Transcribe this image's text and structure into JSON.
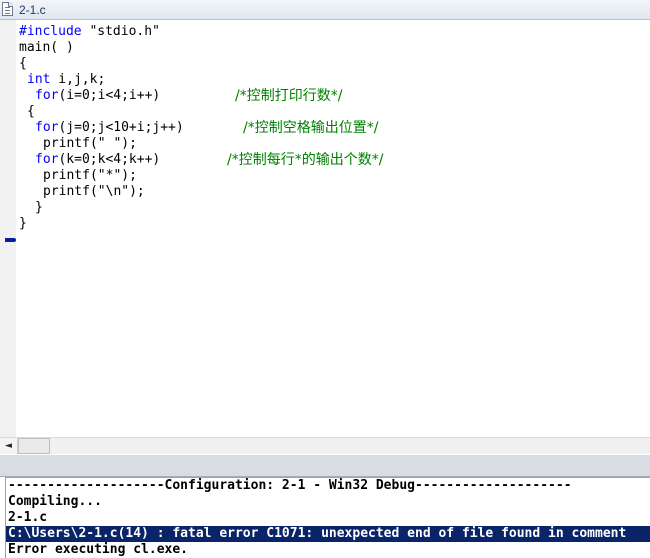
{
  "window": {
    "title": "2-1.c"
  },
  "editor": {
    "lines": [
      {
        "kw": "#include",
        "text": " \"stdio.h\"",
        "comment": ""
      },
      {
        "kw": "",
        "text": "main( )",
        "comment": ""
      },
      {
        "kw": "",
        "text": "{",
        "comment": ""
      },
      {
        "kw": "int",
        "text": " i,j,k;",
        "comment": ""
      },
      {
        "kw": "for",
        "text": "(i=0;i<4;i++)",
        "comment": "/*控制打印行数*/"
      },
      {
        "kw": "",
        "text": "{",
        "comment": ""
      },
      {
        "kw": "for",
        "text": "(j=0;j<10+i;j++)",
        "comment": "/*控制空格输出位置*/"
      },
      {
        "kw": "",
        "text": "printf(\" \");",
        "comment": ""
      },
      {
        "kw": "for",
        "text": "(k=0;k<4;k++)",
        "comment": "/*控制每行*的输出个数*/"
      },
      {
        "kw": "",
        "text": "printf(\"*\");",
        "comment": ""
      },
      {
        "kw": "",
        "text": "printf(\"\\n\");",
        "comment": ""
      },
      {
        "kw": "",
        "text": "}",
        "comment": ""
      },
      {
        "kw": "",
        "text": "}",
        "comment": ""
      }
    ]
  },
  "scrollbar": {
    "left_arrow": "◄"
  },
  "output": {
    "lines": [
      "--------------------Configuration: 2-1 - Win32 Debug--------------------",
      "Compiling...",
      "2-1.c",
      "C:\\Users\\2-1.c(14) : fatal error C1071: unexpected end of file found in comment",
      "Error executing cl.exe."
    ],
    "selected_index": 3
  }
}
